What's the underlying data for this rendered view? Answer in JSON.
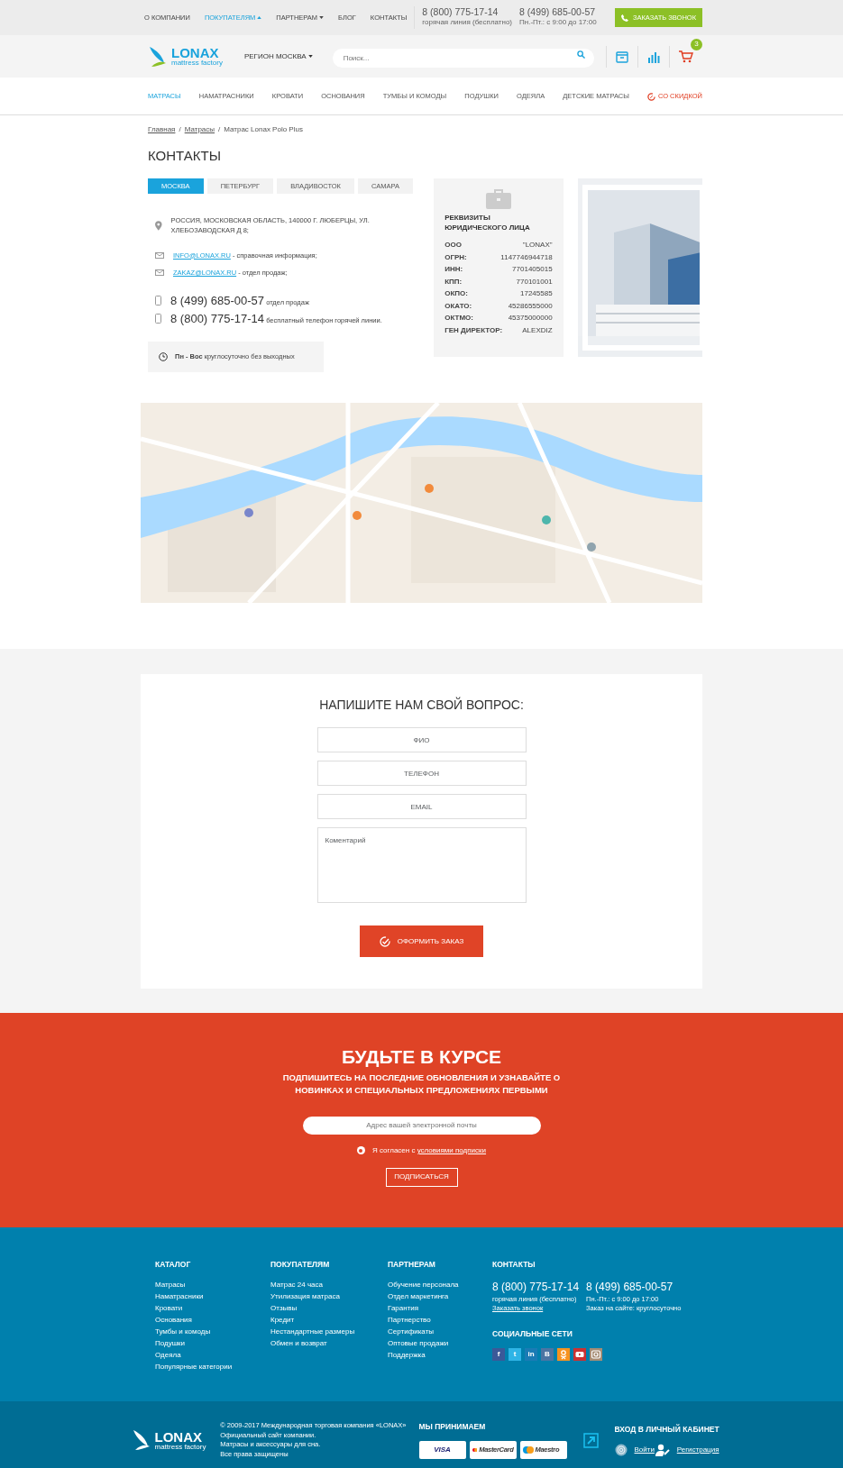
{
  "top_bar": {
    "links": [
      {
        "label": "О КОМПАНИИ",
        "selected": false
      },
      {
        "label": "ПОКУПАТЕЛЯМ",
        "selected": true,
        "expanded": true
      },
      {
        "label": "ПАРТНЕРАМ",
        "selected": false,
        "expanded": false
      },
      {
        "label": "БЛОГ",
        "selected": false
      },
      {
        "label": "КОНТАКТЫ",
        "selected": false
      }
    ],
    "phones": [
      {
        "number": "8 (800) 775-17-14",
        "note": "горячая линия (бесплатно)"
      },
      {
        "number": "8 (499) 685-00-57",
        "note": "Пн.-Пт.: с 9:00 до 17:00"
      }
    ],
    "callback_button": "ЗАКАЗАТЬ ЗВОНОК"
  },
  "header": {
    "logo": {
      "name": "LONAX",
      "tagline": "mattress factory"
    },
    "region": "РЕГИОН МОСКВА",
    "search": {
      "placeholder": "Поиск..."
    },
    "cart_count": "3"
  },
  "nav": [
    {
      "label": "МАТРАСЫ",
      "selected": true,
      "kind": "link"
    },
    {
      "label": "НАМАТРАСНИКИ",
      "selected": false,
      "kind": "link"
    },
    {
      "label": "КРОВАТИ",
      "selected": false,
      "kind": "link"
    },
    {
      "label": "ОСНОВАНИЯ",
      "selected": false,
      "kind": "link"
    },
    {
      "label": "ТУМБЫ И КОМОДЫ",
      "selected": false,
      "kind": "link"
    },
    {
      "label": "ПОДУШКИ",
      "selected": false,
      "kind": "link"
    },
    {
      "label": "ОДЕЯЛА",
      "selected": false,
      "kind": "link"
    },
    {
      "label": "ДЕТСКИЕ МАТРАСЫ",
      "selected": false,
      "kind": "link"
    },
    {
      "label": "СО СКИДКОЙ",
      "selected": false,
      "kind": "sale"
    }
  ],
  "breadcrumb": [
    {
      "kind": "link",
      "label": "Главная"
    },
    {
      "kind": "separator",
      "label": "/"
    },
    {
      "kind": "link",
      "label": "Матрасы"
    },
    {
      "kind": "separator",
      "label": "/"
    },
    {
      "kind": "current",
      "label": "Матрас Lonax Polo Plus"
    }
  ],
  "page_title": "КОНТАКТЫ",
  "city_tabs": [
    {
      "label": "МОСКВА",
      "selected": true
    },
    {
      "label": "ПЕТЕРБУРГ",
      "selected": false
    },
    {
      "label": "ВЛАДИВОСТОК",
      "selected": false
    },
    {
      "label": "САМАРА",
      "selected": false
    }
  ],
  "contacts": {
    "address": "РОССИЯ, МОСКОВСКАЯ ОБЛАСТЬ, 140000 Г. ЛЮБЕРЦЫ, УЛ. ХЛЕБОЗАВОДСКАЯ Д 8;",
    "emails": [
      {
        "email": "INFO@LONAX.RU",
        "note": " - справочная информация;"
      },
      {
        "email": "ZAKAZ@LONAX.RU",
        "note": " - отдел продаж;"
      }
    ],
    "phones": [
      {
        "number": "8 (499) 685-00-57",
        "note": "отдел продаж"
      },
      {
        "number": "8 (800) 775-17-14",
        "note": "бесплатный телефон горячей линии."
      }
    ],
    "hours": "**Пн - Вос** круглосуточно без выходных"
  },
  "legal": {
    "title": "РЕКВИЗИТЫ ЮРИДИЧЕСКОГО ЛИЦА",
    "rows": [
      {
        "label": "ООО",
        "value": "\"LONAX\""
      },
      {
        "label": "ОГРН:",
        "value": "1147746944718"
      },
      {
        "label": "ИНН:",
        "value": "7701405015"
      },
      {
        "label": "КПП:",
        "value": "770101001"
      },
      {
        "label": "ОКПО:",
        "value": "17245585"
      },
      {
        "label": "ОКАТО:",
        "value": "45286555000"
      },
      {
        "label": "ОКТМО:",
        "value": "45375000000"
      },
      {
        "label": "ГЕН ДИРЕКТОР:",
        "value": "ALEXDIZ"
      }
    ]
  },
  "contact_form": {
    "title": "НАПИШИТЕ НАМ СВОЙ ВОПРОС:",
    "fields": [
      {
        "placeholder": "ФИО",
        "kind": "input"
      },
      {
        "placeholder": "ТЕЛЕФОН",
        "kind": "input"
      },
      {
        "placeholder": "EMAIL",
        "kind": "input"
      },
      {
        "placeholder": "Коментарий",
        "kind": "textarea"
      }
    ],
    "submit": "ОФОРМИТЬ ЗАКАЗ"
  },
  "subscribe": {
    "title": "БУДЬТЕ В КУРСЕ",
    "subtitle": "ПОДПИШИТЕСЬ НА ПОСЛЕДНИЕ ОБНОВЛЕНИЯ И УЗНАВАЙТЕ О НОВИНКАХ И СПЕЦИАЛЬНЫХ ПРЕДЛОЖЕНИЯХ ПЕРВЫМИ",
    "email_placeholder": "Адрес вашей электронной почты",
    "consent": {
      "text": "Я согласен с ",
      "link": "условиями подписки",
      "checked": true
    },
    "button": "ПОДПИСАТЬСЯ"
  },
  "footer": {
    "columns": [
      {
        "title": "КАТАЛОГ",
        "links": [
          "Матрасы",
          "Наматрасники",
          "Кровати",
          "Основания",
          "Тумбы и комоды",
          "Подушки",
          "Одеяла",
          "Популярные категории"
        ]
      },
      {
        "title": "ПОКУПАТЕЛЯМ",
        "links": [
          "Матрас 24 часа",
          "Утилизация матраса",
          "Отзывы",
          "Кредит",
          "Нестандартные размеры",
          "Обмен и возврат"
        ]
      },
      {
        "title": "ПАРТНЕРАМ",
        "links": [
          "Обучение персонала",
          "Отдел маркетинга",
          "Гарантия",
          "Партнерство",
          "Сертификаты",
          "Оптовые продажи",
          "Поддержка"
        ]
      }
    ],
    "contacts": {
      "title": "КОНТАКТЫ",
      "phones": [
        {
          "number": "8 (800) 775-17-14",
          "lines": [
            "горячая линия (бесплатно)"
          ],
          "link": "Заказать звонок"
        },
        {
          "number": "8 (499) 685-00-57",
          "lines": [
            "Пн.-Пт.: с 9:00 до 17:00",
            "Заказ на сайте: круглосуточно"
          ]
        }
      ]
    },
    "social": {
      "title": "СОЦИАЛЬНЫЕ СЕТИ",
      "items": [
        {
          "kind": "glyph",
          "glyph": "f",
          "color": "#3b5998"
        },
        {
          "kind": "glyph",
          "glyph": "t",
          "color": "#2fb4e6"
        },
        {
          "kind": "glyph",
          "glyph": "in",
          "color": "#1a7bb5"
        },
        {
          "kind": "glyph",
          "glyph": "B",
          "color": "#4c75a3"
        },
        {
          "kind": "person",
          "color": "#f7931e"
        },
        {
          "kind": "play",
          "color": "#cd3131"
        },
        {
          "kind": "camera",
          "color": "#a58c74"
        }
      ]
    }
  },
  "bottom": {
    "logo": {
      "name": "LONAX",
      "tagline": "mattress factory"
    },
    "copyright": [
      "© 2009-2017 Международная торговая компания «LONAX»",
      "Официальный сайт компании.",
      "Матрасы и аксессуары для сна.",
      "Все права защищены"
    ],
    "payments": {
      "title": "МЫ ПРИНИМАЕМ",
      "cards": [
        {
          "kind": "visa",
          "label": "VISA"
        },
        {
          "kind": "mastercard",
          "label": "MasterCard"
        },
        {
          "kind": "maestro",
          "label": "Maestro"
        }
      ]
    },
    "account": {
      "title": "ВХОД В ЛИЧНЫЙ КАБИНЕТ",
      "links": [
        {
          "kind": "login",
          "label": "Войти"
        },
        {
          "kind": "register",
          "label": "Регистрация"
        }
      ]
    }
  }
}
